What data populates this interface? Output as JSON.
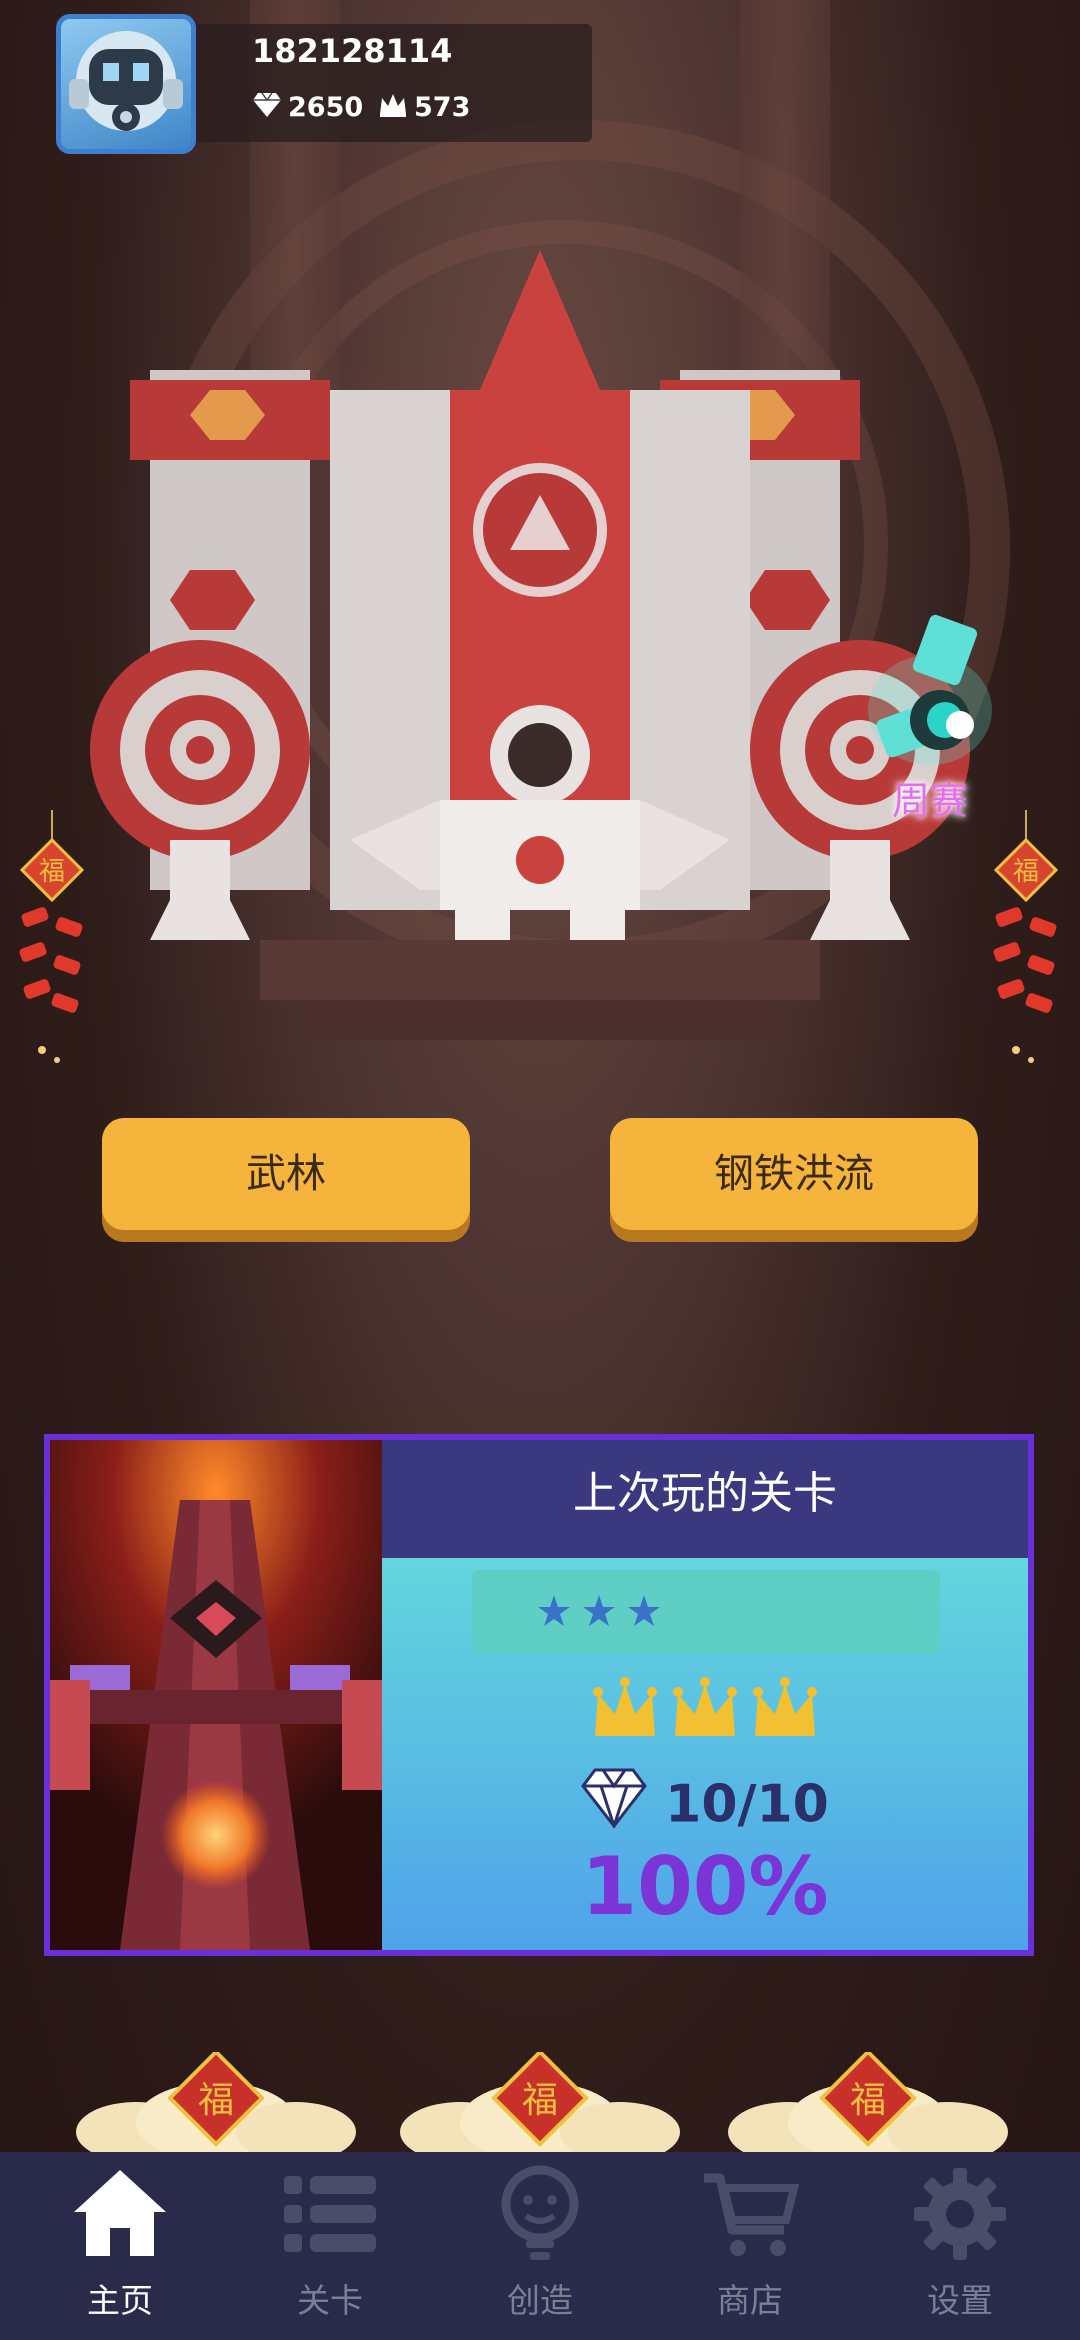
{
  "profile": {
    "user_id": "182128114",
    "diamonds": "2650",
    "crowns": "573"
  },
  "modes": {
    "left_label": "武林",
    "right_label": "钢铁洪流"
  },
  "weekly": {
    "label": "周赛"
  },
  "decor": {
    "fu": "福"
  },
  "last_played": {
    "title": "上次玩的关卡",
    "stars": 3,
    "crowns": 3,
    "gems": "10/10",
    "percent": "100%"
  },
  "nav": {
    "items": [
      {
        "label": "主页",
        "icon": "home-icon",
        "active": true
      },
      {
        "label": "关卡",
        "icon": "list-icon",
        "active": false
      },
      {
        "label": "创造",
        "icon": "lightbulb-icon",
        "active": false
      },
      {
        "label": "商店",
        "icon": "cart-icon",
        "active": false
      },
      {
        "label": "设置",
        "icon": "gear-icon",
        "active": false
      }
    ]
  },
  "colors": {
    "button": "#f5b43c",
    "card_border": "#6a2fd6",
    "percent": "#7b34d6",
    "nav_bg": "#2a2b4a"
  }
}
